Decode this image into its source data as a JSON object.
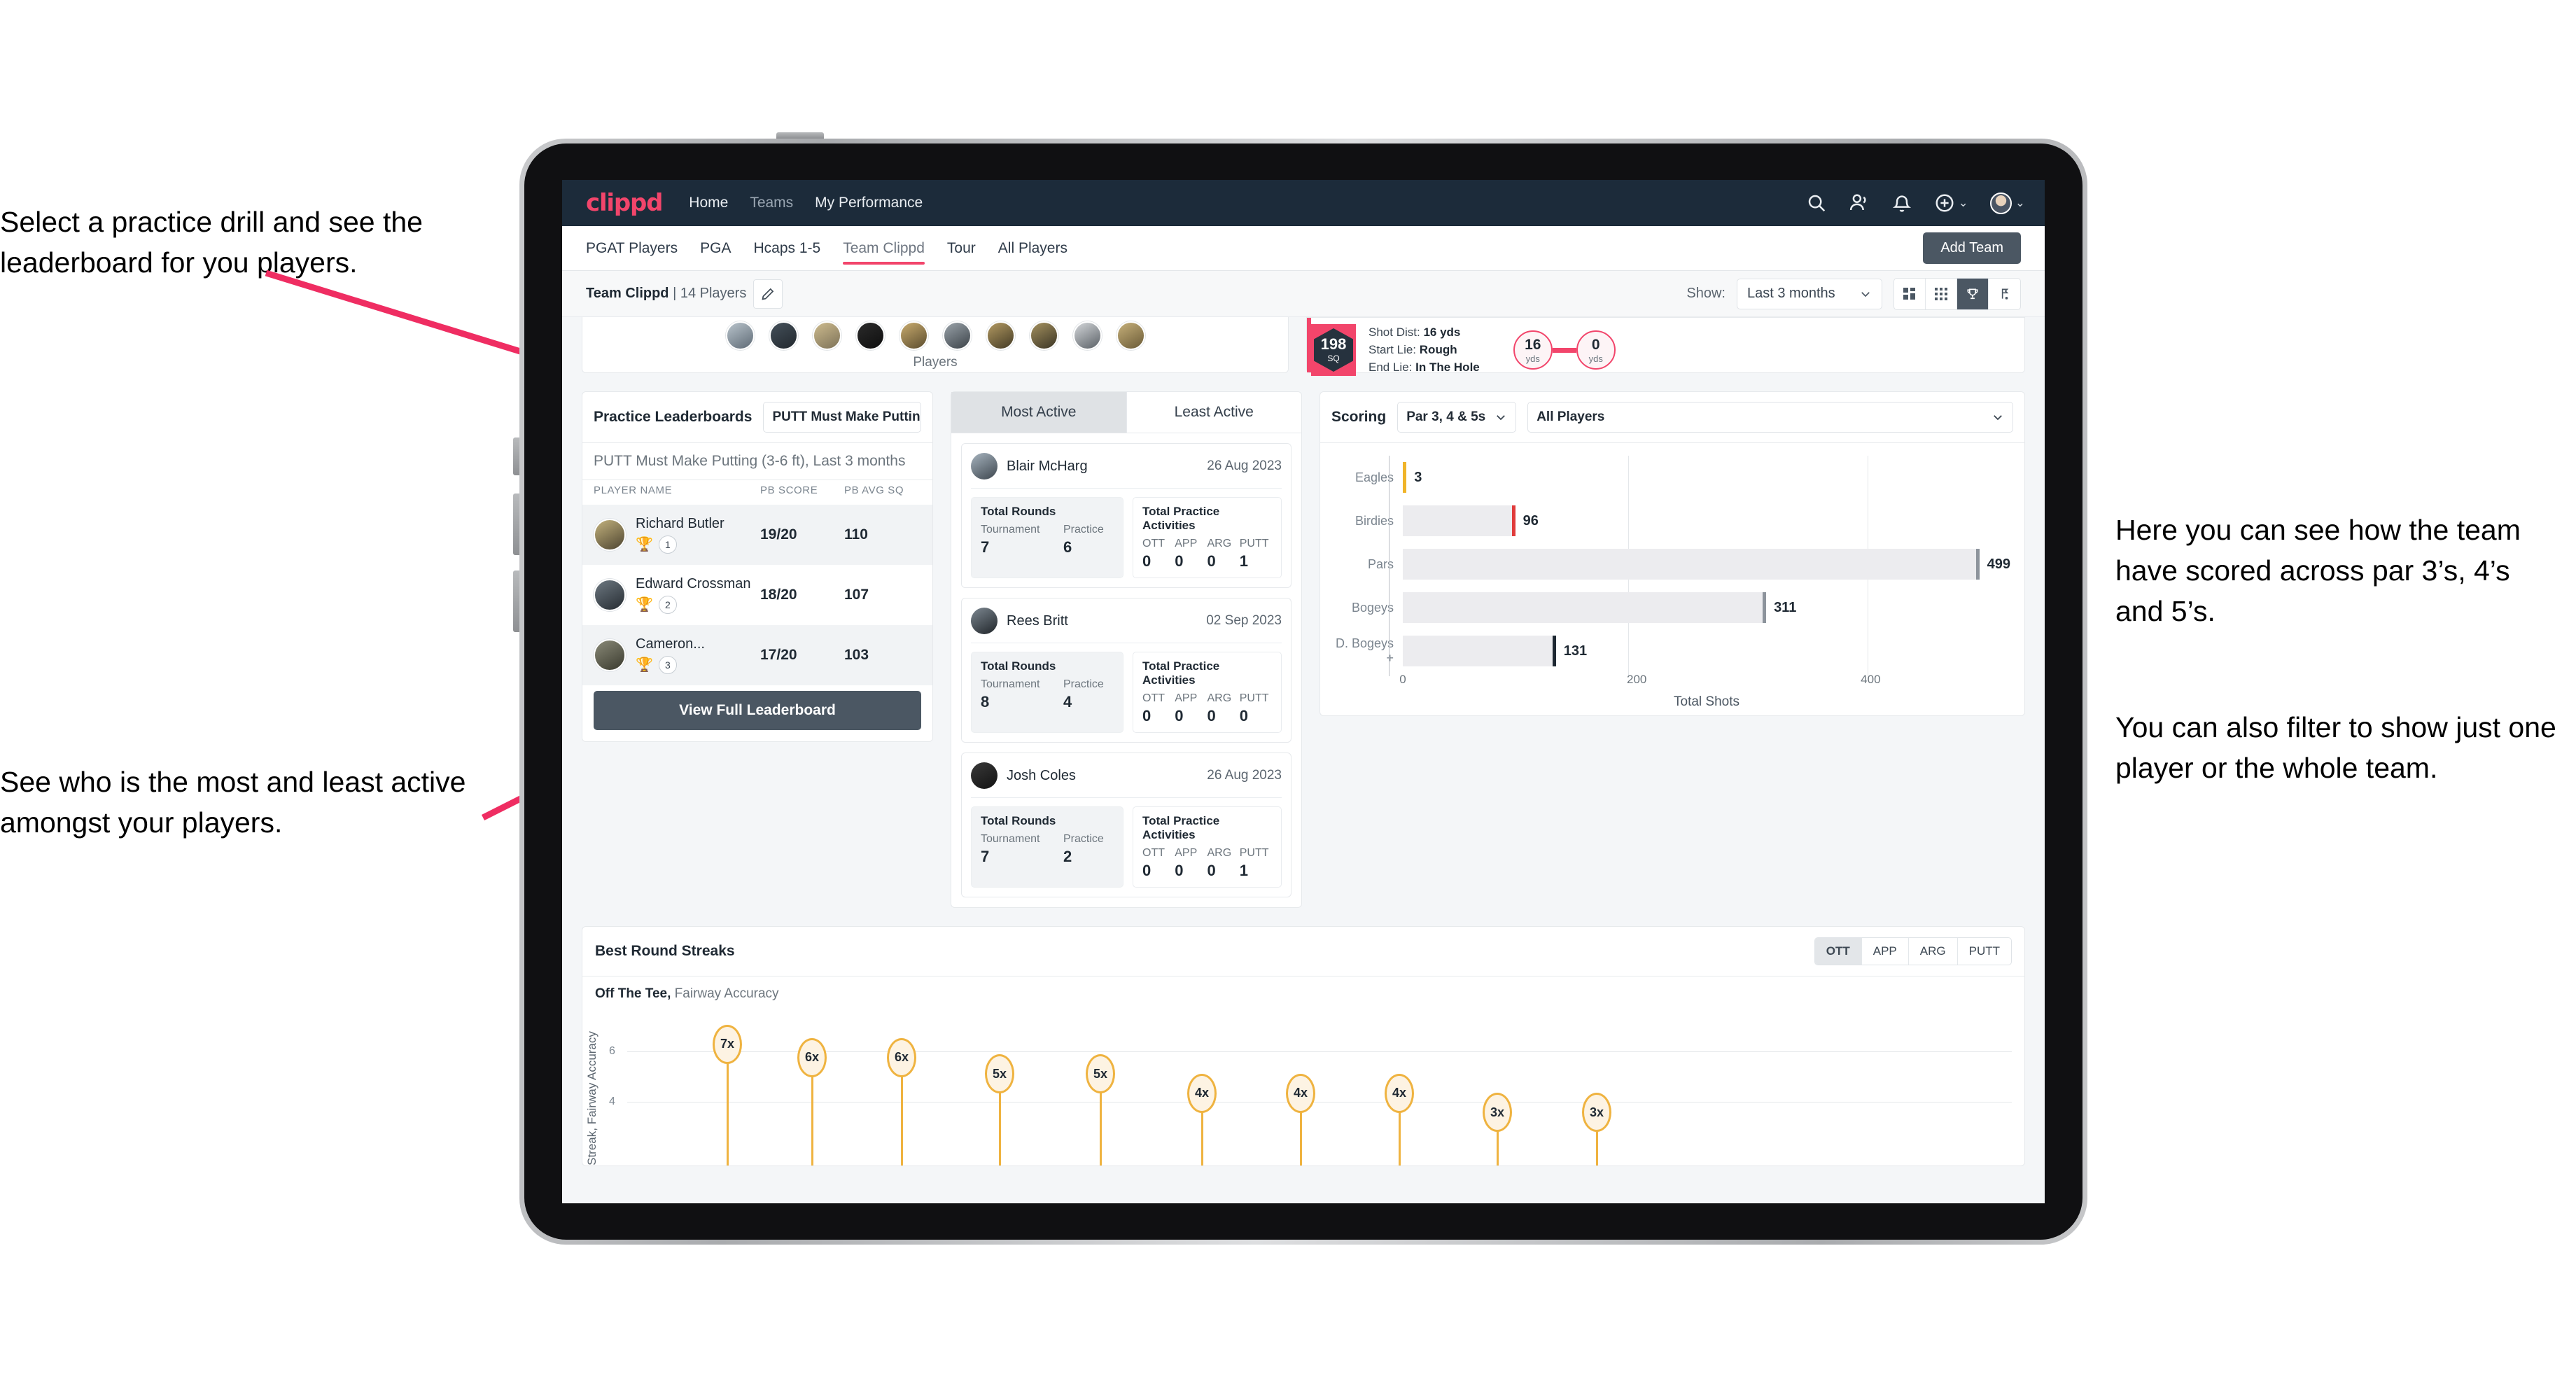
{
  "annotations": {
    "practice": "Select a practice drill and see the leaderboard for you players.",
    "active": "See who is the most and least active amongst your players.",
    "scoring": "Here you can see how the team have scored across par 3’s, 4’s and 5’s.",
    "filter": "You can also filter to show just one player or the whole team."
  },
  "navbar": {
    "logo": "clippd",
    "links": [
      {
        "label": "Home",
        "dim": false
      },
      {
        "label": "Teams",
        "dim": true
      },
      {
        "label": "My Performance",
        "dim": false
      }
    ],
    "icons": [
      "search-icon",
      "people-icon",
      "notification-bell-icon",
      "add-circle-icon",
      "user-avatar"
    ],
    "chevron": "⌄"
  },
  "subnav": {
    "tabs": [
      {
        "label": "PGAT Players",
        "active": false
      },
      {
        "label": "PGA",
        "active": false
      },
      {
        "label": "Hcaps 1-5",
        "active": false
      },
      {
        "label": "Team Clippd",
        "active": true
      },
      {
        "label": "Tour",
        "active": false
      },
      {
        "label": "All Players",
        "active": false
      }
    ],
    "add_team_label": "Add Team",
    "accent": "#f2456b"
  },
  "toolbar": {
    "team_name": "Team Clippd",
    "team_separator": " | ",
    "team_count": "14 Players",
    "edit_icon": "pencil-icon",
    "show_label": "Show:",
    "range_value": "Last 3 months",
    "view_modes": [
      "grid-large-icon",
      "grid-small-icon",
      "trophy-icon",
      "flag-icon"
    ],
    "active_view_index": 2
  },
  "players_strip": {
    "caption": "Players",
    "count": 11
  },
  "shot_card": {
    "sq_value": "198",
    "sq_unit": "SQ",
    "lines": [
      {
        "label": "Shot Dist:",
        "value": "16 yds"
      },
      {
        "label": "Start Lie:",
        "value": "Rough"
      },
      {
        "label": "End Lie:",
        "value": "In The Hole"
      }
    ],
    "start_yards": "16",
    "start_unit": "yds",
    "end_yards": "0",
    "end_unit": "yds"
  },
  "leaderboard": {
    "title": "Practice Leaderboards",
    "drill_select": "PUTT Must Make Putting ...",
    "drill_title": "PUTT Must Make Putting (3-6 ft),",
    "drill_period": " Last 3 months",
    "columns": [
      "PLAYER NAME",
      "PB SCORE",
      "PB AVG SQ"
    ],
    "rows": [
      {
        "name": "Richard Butler",
        "trophy": "gold",
        "rank": "1",
        "score": "19/20",
        "sq": "110"
      },
      {
        "name": "Edward Crossman",
        "trophy": "silver",
        "rank": "2",
        "score": "18/20",
        "sq": "107"
      },
      {
        "name": "Cameron...",
        "trophy": "bronze",
        "rank": "3",
        "score": "17/20",
        "sq": "103"
      }
    ],
    "button_label": "View Full Leaderboard"
  },
  "activity": {
    "tabs": [
      {
        "label": "Most Active",
        "active": true
      },
      {
        "label": "Least Active",
        "active": false
      }
    ],
    "rounds_title": "Total Rounds",
    "rounds_cols": [
      "Tournament",
      "Practice"
    ],
    "practice_title": "Total Practice Activities",
    "practice_cols": [
      "OTT",
      "APP",
      "ARG",
      "PUTT"
    ],
    "cards": [
      {
        "name": "Blair McHarg",
        "date": "26 Aug 2023",
        "tournament": "7",
        "practice": "6",
        "ott": "0",
        "app": "0",
        "arg": "0",
        "putt": "1"
      },
      {
        "name": "Rees Britt",
        "date": "02 Sep 2023",
        "tournament": "8",
        "practice": "4",
        "ott": "0",
        "app": "0",
        "arg": "0",
        "putt": "0"
      },
      {
        "name": "Josh Coles",
        "date": "26 Aug 2023",
        "tournament": "7",
        "practice": "2",
        "ott": "0",
        "app": "0",
        "arg": "0",
        "putt": "1"
      }
    ]
  },
  "scoring": {
    "title": "Scoring",
    "par_select": "Par 3, 4 & 5s",
    "player_select": "All Players"
  },
  "streaks": {
    "title": "Best Round Streaks",
    "toggle": [
      {
        "label": "OTT",
        "active": true
      },
      {
        "label": "APP",
        "active": false
      },
      {
        "label": "ARG",
        "active": false
      },
      {
        "label": "PUTT",
        "active": false
      }
    ],
    "subtitle_bold": "Off The Tee,",
    "subtitle_light": " Fairway Accuracy"
  },
  "chart_data": [
    {
      "type": "bar",
      "orientation": "horizontal",
      "title": "Scoring",
      "categories": [
        "Eagles",
        "Birdies",
        "Pars",
        "Bogeys",
        "D. Bogeys +"
      ],
      "values": [
        3,
        96,
        499,
        311,
        131
      ],
      "bar_colors": [
        "#f0b429",
        "#e03b3b",
        "#8d949c",
        "#8d949c",
        "#1f2933"
      ],
      "xlabel": "Total Shots",
      "ylabel": "",
      "xlim": [
        0,
        520
      ],
      "xticks": [
        0,
        200,
        400
      ],
      "grid": true,
      "legend": false
    },
    {
      "type": "scatter",
      "subtype": "lollipop",
      "title": "Best Round Streaks",
      "series_name": "Off The Tee, Fairway Accuracy",
      "ylabel": "Streak, Fairway Accuracy",
      "xlabel": "",
      "yticks": [
        4,
        6
      ],
      "ylim": [
        0,
        7.8
      ],
      "values": [
        7,
        6,
        6,
        5,
        5,
        4,
        4,
        4,
        3,
        3
      ],
      "labels": [
        "7x",
        "6x",
        "6x",
        "5x",
        "5x",
        "4x",
        "4x",
        "4x",
        "3x",
        "3x"
      ],
      "grid": true,
      "legend": false,
      "color": "#efb340"
    }
  ]
}
